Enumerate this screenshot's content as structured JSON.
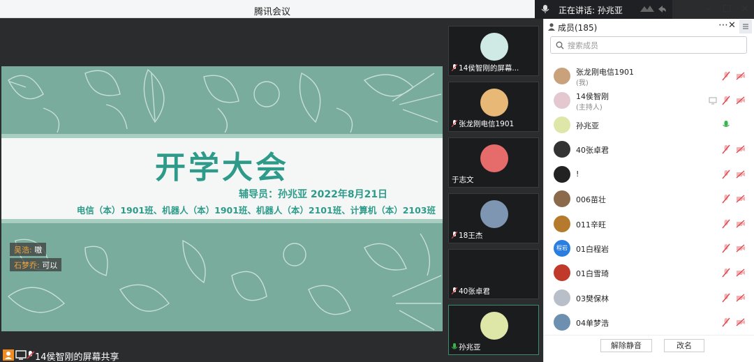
{
  "window": {
    "title": "腾讯会议"
  },
  "speaking": {
    "text": "正在讲话: 孙兆亚"
  },
  "slide": {
    "title": "开学大会",
    "subtitle": "辅导员：孙兆亚    2022年8月21日",
    "classes": "电信（本）1901班、机器人（本）1901班、机器人（本）2101班、计算机（本）2103班"
  },
  "chat": [
    {
      "name": "吴浩:",
      "msg": "嗷"
    },
    {
      "name": "石梦乔:",
      "msg": "可以"
    }
  ],
  "share_status": {
    "label": "14侯智刚的屏幕共享"
  },
  "video_tiles": [
    {
      "name": "14侯智刚的屏幕...",
      "avatar": "#cfe9e4"
    },
    {
      "name": "张龙刚电信1901",
      "avatar": "#e8b877"
    },
    {
      "name": "于志文",
      "avatar": "#e66b6b"
    },
    {
      "name": "18王杰",
      "avatar": "#7f96b3"
    },
    {
      "name": "40张卓君",
      "avatar": ""
    },
    {
      "name": "孙兆亚",
      "avatar": "#dfe7a8"
    }
  ],
  "panel": {
    "title": "成员(185)",
    "search_placeholder": "搜索成员",
    "members": [
      {
        "name": "张龙刚电信1901",
        "sub": "(我)",
        "color": "#c9a27c",
        "mic": "muted"
      },
      {
        "name": "14侯智刚",
        "sub": "(主持人)",
        "color": "#e3c9cf",
        "mic": "muted",
        "screen": true
      },
      {
        "name": "孙兆亚",
        "sub": "",
        "color": "#dfe7a8",
        "mic": "active"
      },
      {
        "name": "40张卓君",
        "sub": "",
        "color": "#333333",
        "mic": "muted"
      },
      {
        "name": "!",
        "sub": "",
        "color": "#222222",
        "mic": "muted"
      },
      {
        "name": "006苗壮",
        "sub": "",
        "color": "#8a6a4a",
        "mic": "muted"
      },
      {
        "name": "011辛旺",
        "sub": "",
        "color": "#b57a2b",
        "mic": "muted"
      },
      {
        "name": "01白程岩",
        "sub": "",
        "color": "#2a7de1",
        "mic": "muted",
        "badge": "程岩"
      },
      {
        "name": "01白雪琦",
        "sub": "",
        "color": "#c0392b",
        "mic": "muted"
      },
      {
        "name": "03樊保林",
        "sub": "",
        "color": "#b9bfc8",
        "mic": "muted"
      },
      {
        "name": "04单梦浩",
        "sub": "",
        "color": "#6d8fb0",
        "mic": "muted"
      }
    ],
    "unmute_all_label": "解除静音",
    "rename_label": "改名"
  },
  "colors": {
    "accent": "#2e9b8a",
    "slide_bg": "#79ac9c",
    "muted_red": "#e0454b",
    "active_green": "#39b54a"
  }
}
